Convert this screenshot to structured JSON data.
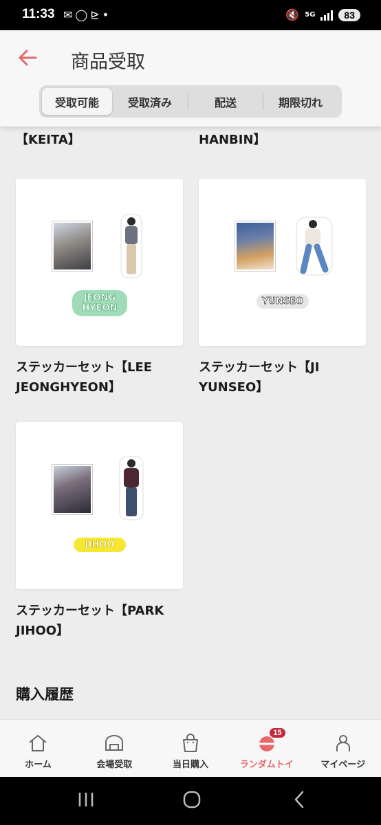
{
  "status_bar": {
    "time": "11:33",
    "notification_icons": [
      "mail-icon",
      "chat-bubble-icon",
      "app-icon",
      "dot-icon"
    ],
    "network": "5G",
    "battery": "83"
  },
  "header": {
    "title": "商品受取",
    "tabs": [
      {
        "label": "受取可能",
        "active": true
      },
      {
        "label": "受取済み",
        "active": false
      },
      {
        "label": "配送",
        "active": false
      },
      {
        "label": "期限切れ",
        "active": false
      }
    ]
  },
  "products": {
    "prev_left_title": "ステッカーセット\n【KEITA】",
    "prev_right_title": "ステッカーセット【PARK\nHANBIN】",
    "items": [
      {
        "title": "ステッカーセット【LEE\nJEONGHYEON】",
        "sticker_text": "JEONG\nHYEON",
        "sticker_color": "#9fdcb7"
      },
      {
        "title": "ステッカーセット【JI\nYUNSEO】",
        "sticker_text": "YUNSEO",
        "sticker_color": "#e6e6e6"
      },
      {
        "title": "ステッカーセット【PARK\nJIHOO】",
        "sticker_text": "JIHOO",
        "sticker_color": "#f6e832"
      }
    ]
  },
  "section_heading": "購入履歴",
  "bottom_nav": {
    "items": [
      {
        "label": "ホーム",
        "icon": "home-icon"
      },
      {
        "label": "会場受取",
        "icon": "store-icon"
      },
      {
        "label": "当日購入",
        "icon": "shopping-bag-icon"
      },
      {
        "label": "ランダムトイ",
        "icon": "random-toy-icon",
        "active": true,
        "badge": "15"
      },
      {
        "label": "マイページ",
        "icon": "person-icon"
      }
    ]
  },
  "colors": {
    "accent": "#e8676a",
    "badge": "#c22a3a",
    "background": "#ededed"
  }
}
